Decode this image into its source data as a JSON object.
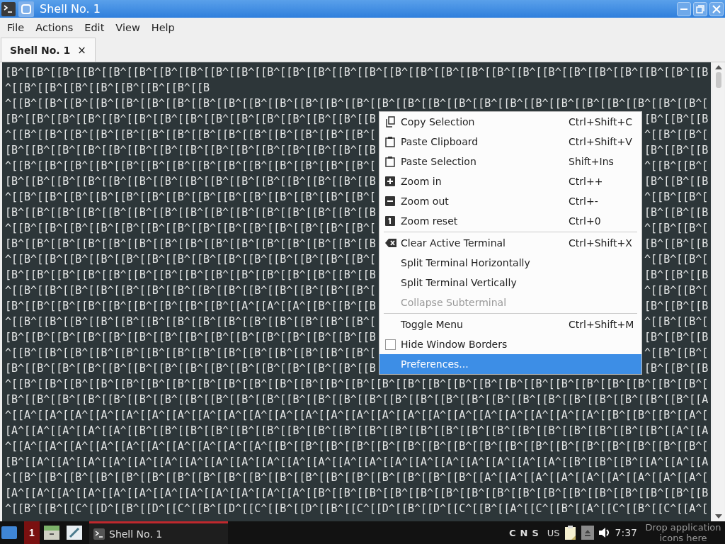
{
  "window": {
    "title": "Shell No. 1"
  },
  "menu_bar": [
    "File",
    "Actions",
    "Edit",
    "View",
    "Help"
  ],
  "tabs": [
    {
      "label": "Shell No. 1",
      "selected": true,
      "close": "×"
    }
  ],
  "terminal": {
    "lines": [
      {
        "text": "[B^[[B^[[B^[[B^[[B^[[B^[[B^[[B^[[B^[[B^[[B^[[B^[[B^[[B^[[B^[[B^[[B^[[B^[[B^[[B^[[B^[[B^[[B^[[B^[[B^[[B^[[B^[[B"
      },
      {
        "text": "^[[B^[[B^[[B^[[B^[[B^[[B^[[B^[[B"
      },
      {
        "text": "^[[B^[[B^[[B^[[B^[[B^[[B^[[B^[[B^[[B^[[B^[[B^[[B^[[B^[[B^[[B^[[B^[[B^[[B^[[B^[[B^[[B^[[B^[[B^[[B^[[B^[[B^[[B^["
      },
      {
        "left": "[B^[[B^[[B^[[B^[[B^[[B^[[B^[[B^[[B^[[B^[[B^[[B^[[B^[[B^[[B",
        "right": "[B^[[B^[[B"
      },
      {
        "left": "^[[B^[[B^[[B^[[B^[[B^[[B^[[B^[[B^[[B^[[B^[[B^[[B^[[B^[[B^[",
        "right": "^[[B^[[B^["
      },
      {
        "left": "[B^[[B^[[B^[[B^[[B^[[B^[[B^[[B^[[B^[[B^[[B^[[B^[[B^[[B^[[B",
        "right": "[B^[[B^[[B"
      },
      {
        "left": "^[[B^[[B^[[B^[[B^[[B^[[B^[[B^[[B^[[B^[[B^[[B^[[B^[[B^[[B^[",
        "right": "^[[B^[[B^["
      },
      {
        "left": "[B^[[B^[[B^[[B^[[B^[[B^[[B^[[B^[[B^[[B^[[B^[[B^[[B^[[B^[[B",
        "right": "[B^[[B^[[B"
      },
      {
        "left": "^[[B^[[B^[[B^[[B^[[B^[[B^[[B^[[B^[[B^[[B^[[B^[[B^[[B^[[B^[",
        "right": "^[[B^[[B^["
      },
      {
        "left": "[B^[[B^[[B^[[B^[[B^[[B^[[B^[[B^[[B^[[B^[[B^[[B^[[B^[[B^[[B",
        "right": "[B^[[B^[[B"
      },
      {
        "left": "^[[B^[[B^[[B^[[B^[[B^[[B^[[B^[[B^[[B^[[B^[[B^[[B^[[B^[[B^[",
        "right": "^[[B^[[B^["
      },
      {
        "left": "[B^[[B^[[B^[[B^[[B^[[B^[[B^[[B^[[B^[[B^[[B^[[B^[[B^[[B^[[B",
        "right": "[B^[[B^[[B"
      },
      {
        "left": "^[[B^[[B^[[B^[[B^[[B^[[B^[[B^[[B^[[B^[[B^[[B^[[B^[[B^[[B^[",
        "right": "^[[B^[[B^["
      },
      {
        "left": "[B^[[B^[[B^[[B^[[B^[[B^[[B^[[B^[[B^[[B^[[B^[[B^[[B^[[B^[[B",
        "right": "[B^[[B^[[B"
      },
      {
        "left": "^[[B^[[B^[[B^[[B^[[B^[[B^[[B^[[B^[[B^[[B^[[B^[[B^[[B^[[B^[",
        "right": "^[[B^[[B^["
      },
      {
        "left": "[B^[[B^[[B^[[B^[[B^[[B^[[B^[[B^[[B^[[A^[[A^[[A^[[B^[[B^[[B",
        "right": "[B^[[B^[[B"
      },
      {
        "left": "^[[B^[[B^[[B^[[B^[[B^[[B^[[B^[[B^[[B^[[B^[[B^[[B^[[B^[[B^[",
        "right": "^[[B^[[B^["
      },
      {
        "left": "[B^[[B^[[B^[[B^[[B^[[B^[[B^[[B^[[B^[[B^[[B^[[B^[[B^[[B^[[B",
        "right": "[B^[[B^[[B"
      },
      {
        "left": "^[[B^[[B^[[B^[[B^[[B^[[B^[[B^[[B^[[B^[[B^[[B^[[B^[[B^[[B^[",
        "right": "^[[B^[[B^["
      },
      {
        "left": "[B^[[B^[[B^[[B^[[B^[[B^[[B^[[B^[[B^[[B^[[B^[[B^[[B^[[B^[[B",
        "right": "[B^[[B^[[B"
      },
      {
        "text": "^[[B^[[B^[[B^[[B^[[B^[[B^[[B^[[B^[[B^[[B^[[B^[[B^[[B^[[B^[[B^[[B^[[B^[[B^[[B^[[B^[[B^[[B^[[B^[[B^[[B^[[B^[[B^["
      },
      {
        "text": "[B^[[B^[[B^[[B^[[B^[[B^[[B^[[B^[[B^[[B^[[B^[[B^[[B^[[B^[[B^[[B^[[B^[[B^[[B^[[B^[[B^[[B^[[B^[[B^[[B^[[B^[[B^[[A"
      },
      {
        "text": "^[[A^[[A^[[A^[[A^[[A^[[A^[[A^[[A^[[A^[[A^[[A^[[A^[[A^[[A^[[A^[[A^[[A^[[A^[[A^[[A^[[A^[[A^[[A^[[B^[[B^[[B^[[A^["
      },
      {
        "text": "[A^[[A^[[A^[[A^[[A^[[B^[[B^[[B^[[B^[[B^[[B^[[B^[[B^[[B^[[B^[[B^[[B^[[B^[[B^[[B^[[B^[[B^[[B^[[B^[[B^[[B^[[A^[[A"
      },
      {
        "text": "^[[A^[[A^[[A^[[A^[[A^[[A^[[A^[[A^[[A^[[A^[[B^[[B^[[B^[[B^[[B^[[B^[[B^[[B^[[B^[[B^[[B^[[B^[[B^[[B^[[B^[[B^[[B^["
      },
      {
        "text": "[B^[[A^[[A^[[A^[[A^[[A^[[A^[[A^[[A^[[A^[[A^[[A^[[A^[[A^[[A^[[A^[[A^[[A^[[A^[[A^[[A^[[A^[[B^[[B^[[B^[[A^[[A^[[A"
      },
      {
        "text": "^[[B^[[B^[[B^[[B^[[B^[[B^[[B^[[B^[[B^[[B^[[B^[[B^[[B^[[B^[[B^[[B^[[B^[[B^[[A^[[A^[[A^[[A^[[A^[[A^[[A^[[A^[[A^["
      },
      {
        "text": "[A^[[A^[[A^[[A^[[A^[[A^[[A^[[A^[[A^[[A^[[A^[[A^[[B^[[B^[[B^[[B^[[B^[[B^[[B^[[B^[[B^[[B^[[B^[[B^[[B^[[B^[[B^[[B"
      },
      {
        "text": "^[[B^[[B^[[C^[[D^[[B^[[D^[[C^[[B^[[D^[[C^[[B^[[D^[[B^[[C^[[D^[[B^[[D^[[C^[[B^[[A^[[C^[[B^[[A^[[C^[[B^[[C^[[A^["
      }
    ]
  },
  "context_menu": {
    "sections": [
      [
        {
          "kind": "action",
          "label": "Copy Selection",
          "shortcut": "Ctrl+Shift+C",
          "disabled": false,
          "selected": false
        },
        {
          "kind": "action",
          "label": "Paste Clipboard",
          "shortcut": "Ctrl+Shift+V",
          "disabled": false,
          "selected": false
        },
        {
          "kind": "action",
          "label": "Paste Selection",
          "shortcut": "Shift+Ins",
          "disabled": false,
          "selected": false
        },
        {
          "kind": "action",
          "label": "Zoom in",
          "shortcut": "Ctrl++",
          "disabled": false,
          "selected": false
        },
        {
          "kind": "action",
          "label": "Zoom out",
          "shortcut": "Ctrl+-",
          "disabled": false,
          "selected": false
        },
        {
          "kind": "action",
          "label": "Zoom reset",
          "shortcut": "Ctrl+0",
          "disabled": false,
          "selected": false
        }
      ],
      [
        {
          "kind": "action",
          "label": "Clear Active Terminal",
          "shortcut": "Ctrl+Shift+X",
          "disabled": false,
          "selected": false
        },
        {
          "kind": "action",
          "label": "Split Terminal Horizontally",
          "disabled": false,
          "selected": false
        },
        {
          "kind": "action",
          "label": "Split Terminal Vertically",
          "disabled": false,
          "selected": false
        },
        {
          "kind": "action",
          "label": "Collapse Subterminal",
          "disabled": true,
          "selected": false
        }
      ],
      [
        {
          "kind": "action",
          "label": "Toggle Menu",
          "shortcut": "Ctrl+Shift+M",
          "disabled": false,
          "selected": false
        },
        {
          "kind": "checkbox",
          "label": "Hide Window Borders",
          "checked": false,
          "disabled": false,
          "selected": false
        },
        {
          "kind": "action",
          "label": "Preferences...",
          "disabled": false,
          "selected": true
        }
      ]
    ]
  },
  "taskbar": {
    "workspace": "1",
    "tasks": [
      {
        "label": "Shell No. 1",
        "selected": true
      }
    ],
    "indicators": [
      "C",
      "N",
      "S"
    ],
    "keyboard_layout": "US",
    "clock": "7:37",
    "drop_zone": "Drop application icons here"
  }
}
